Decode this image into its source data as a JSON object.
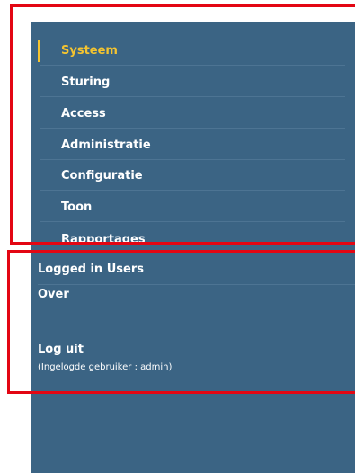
{
  "sidebar": {
    "submenu": [
      {
        "label": "Systeem",
        "active": true
      },
      {
        "label": "Sturing"
      },
      {
        "label": "Access"
      },
      {
        "label": "Administratie"
      },
      {
        "label": "Configuratie"
      },
      {
        "label": "Toon"
      },
      {
        "label": "Rapportages"
      }
    ],
    "logged_in_users": "Logged in Users",
    "about": "Over",
    "logout": "Log uit",
    "logged_in_user": "(Ingelogde gebruiker : admin)"
  },
  "colors": {
    "sidebar_bg": "#3b6484",
    "active_text": "#f4c430",
    "highlight_box": "#e30613"
  }
}
